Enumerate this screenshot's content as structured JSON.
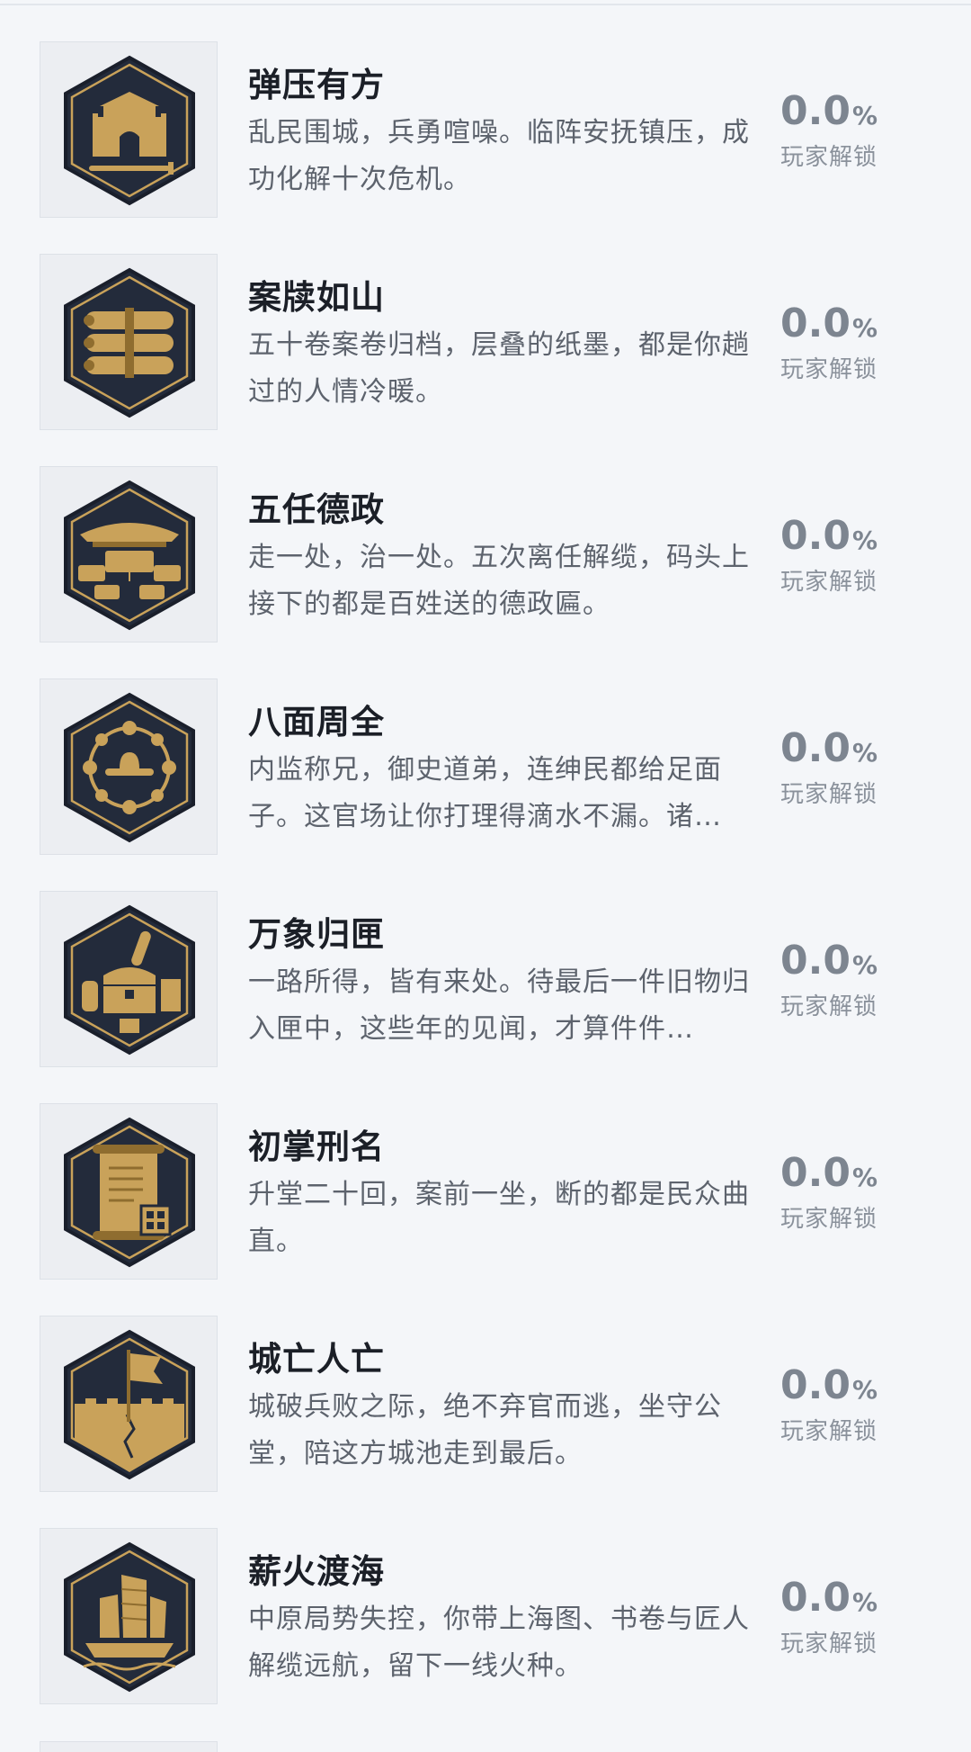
{
  "theme": {
    "badge_dark": "#1e2535",
    "badge_gold": "#c9a25a",
    "badge_gold_dark": "#8f6d2f"
  },
  "achievements": [
    {
      "icon": "city-gate-sword-icon",
      "title": "弹压有方",
      "description": "乱民围城，兵勇喧噪。临阵安抚镇压，成功化解十次危机。",
      "percent": "0.0",
      "percent_sign": "%",
      "unlock_label": "玩家解锁"
    },
    {
      "icon": "scrolls-icon",
      "title": "案牍如山",
      "description": "五十卷案卷归档，层叠的纸墨，都是你趟过的人情冷暖。",
      "percent": "0.0",
      "percent_sign": "%",
      "unlock_label": "玩家解锁"
    },
    {
      "icon": "pavilion-plaques-icon",
      "title": "五任德政",
      "description": "走一处，治一处。五次离任解缆，码头上接下的都是百姓送的德政匾。",
      "percent": "0.0",
      "percent_sign": "%",
      "unlock_label": "玩家解锁"
    },
    {
      "icon": "official-hat-network-icon",
      "title": "八面周全",
      "description": "内监称兄，御史道弟，连绅民都给足面子。这官场让你打理得滴水不漏。诸…",
      "percent": "0.0",
      "percent_sign": "%",
      "unlock_label": "玩家解锁"
    },
    {
      "icon": "treasure-chest-icon",
      "title": "万象归匣",
      "description": "一路所得，皆有来处。待最后一件旧物归入匣中，这些年的见闻，才算件件…",
      "percent": "0.0",
      "percent_sign": "%",
      "unlock_label": "玩家解锁"
    },
    {
      "icon": "scroll-seal-icon",
      "title": "初掌刑名",
      "description": "升堂二十回，案前一坐，断的都是民众曲直。",
      "percent": "0.0",
      "percent_sign": "%",
      "unlock_label": "玩家解锁"
    },
    {
      "icon": "ruined-wall-banner-icon",
      "title": "城亡人亡",
      "description": "城破兵败之际，绝不弃官而逃，坐守公堂，陪这方城池走到最后。",
      "percent": "0.0",
      "percent_sign": "%",
      "unlock_label": "玩家解锁"
    },
    {
      "icon": "junk-ship-icon",
      "title": "薪火渡海",
      "description": "中原局势失控，你带上海图、书卷与匠人解缆远航，留下一线火种。",
      "percent": "0.0",
      "percent_sign": "%",
      "unlock_label": "玩家解锁"
    }
  ]
}
